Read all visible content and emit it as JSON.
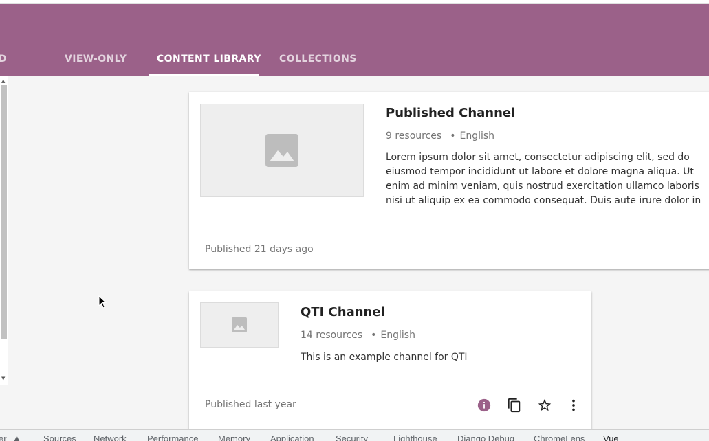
{
  "tabs": [
    {
      "label": "D"
    },
    {
      "label": "VIEW-ONLY"
    },
    {
      "label": "CONTENT LIBRARY"
    },
    {
      "label": "COLLECTIONS"
    }
  ],
  "active_tab": "CONTENT LIBRARY",
  "colors": {
    "brand": "#9b6189",
    "info": "#9b6189"
  },
  "channels": [
    {
      "title": "Published Channel",
      "resources": "9 resources",
      "language": "English",
      "description": "Lorem ipsum dolor sit amet, consectetur adipiscing elit, sed do eiusmod tempor incididunt ut labore et dolore magna aliqua. Ut enim ad minim veniam, quis nostrud exercitation ullamco laboris nisi ut aliquip ex ea commodo consequat. Duis aute irure dolor in reprehenderit in voluptate velit esse cillum dolore eu fugiat nulla pariatur.",
      "published": "Published 21 days ago",
      "thumbnail_icon": "image-placeholder-icon"
    },
    {
      "title": "QTI Channel",
      "resources": "14 resources",
      "language": "English",
      "description": "This is an example channel for QTI",
      "published": "Published last year",
      "thumbnail_icon": "image-placeholder-icon",
      "actions": [
        "info-icon",
        "copy-icon",
        "star-icon",
        "more-vert-icon"
      ]
    }
  ],
  "devtools_tabs": [
    "er",
    "Sources",
    "Network",
    "Performance",
    "Memory",
    "Application",
    "Security",
    "Lighthouse",
    "Django Debug",
    "ChromeLens",
    "Vue"
  ],
  "dot": "•"
}
